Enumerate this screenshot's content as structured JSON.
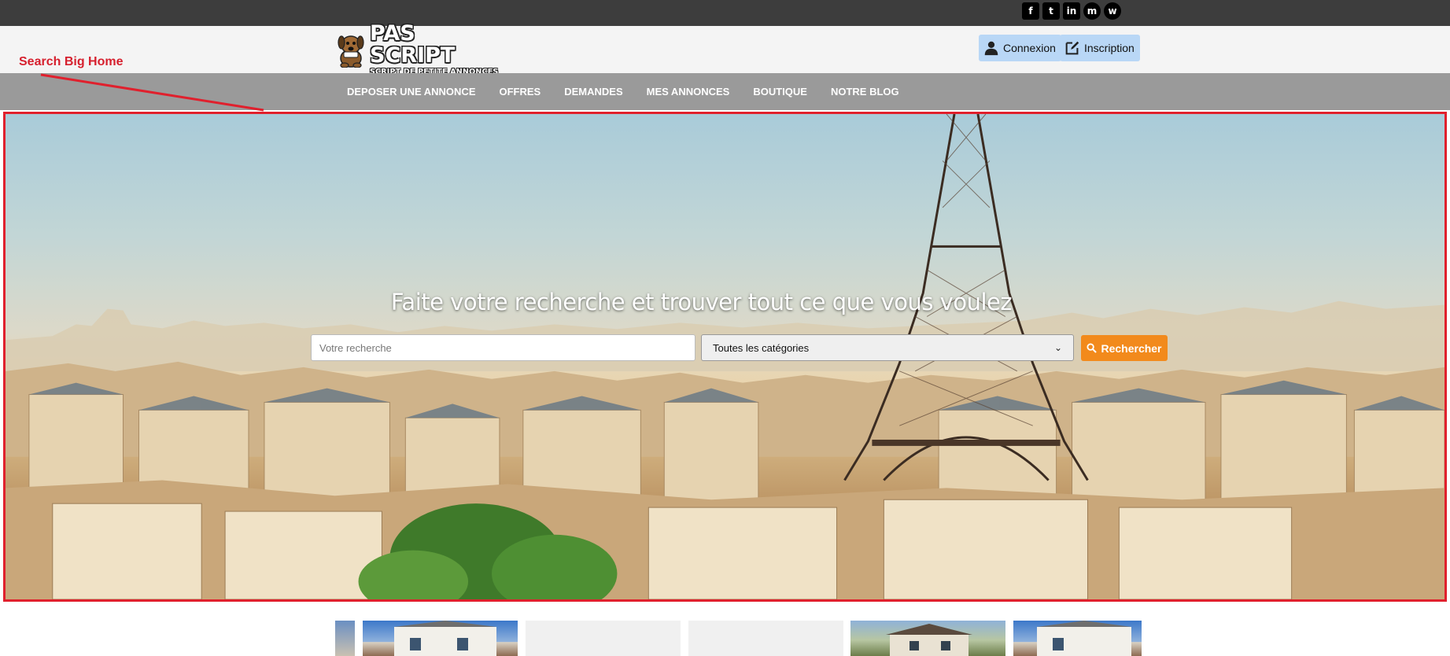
{
  "topbar": {
    "social": [
      {
        "icon": "facebook-icon",
        "glyph": "f"
      },
      {
        "icon": "twitter-icon",
        "glyph": "t"
      },
      {
        "icon": "linkedin-icon",
        "glyph": "in"
      },
      {
        "icon": "messenger-icon",
        "glyph": "m"
      },
      {
        "icon": "whatsapp-icon",
        "glyph": "w"
      }
    ]
  },
  "header": {
    "logo_title": "PAS SCRIPT",
    "logo_subtitle": "SCRIPT DE PETITE ANNONCES",
    "login_label": "Connexion",
    "signup_label": "Inscription"
  },
  "nav": {
    "items": [
      "DEPOSER UNE ANNONCE",
      "OFFRES",
      "DEMANDES",
      "MES ANNONCES",
      "BOUTIQUE",
      "NOTRE BLOG"
    ]
  },
  "annotation": {
    "label": "Search Big Home",
    "color": "#d6202e"
  },
  "hero": {
    "title": "Faite votre recherche et trouver tout ce que vous voulez",
    "search_placeholder": "Votre recherche",
    "search_value": "",
    "category_selected": "Toutes les catégories",
    "search_button": "Rechercher"
  },
  "colors": {
    "topbar": "#3d3d3d",
    "header": "#f4f4f4",
    "nav": "#9a9a9a",
    "auth_button": "#b9d7f6",
    "search_button": "#f28a1c",
    "annotation": "#e0202d"
  }
}
